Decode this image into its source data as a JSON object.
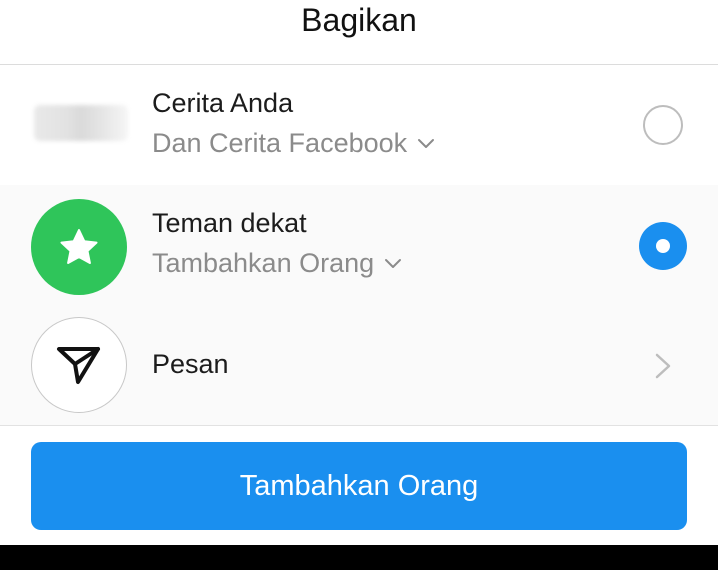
{
  "header": {
    "title": "Bagikan"
  },
  "options": [
    {
      "title": "Cerita Anda",
      "subtitle": "Dan Cerita Facebook",
      "selected": false
    },
    {
      "title": "Teman dekat",
      "subtitle": "Tambahkan Orang",
      "selected": true,
      "icon": "star-icon",
      "icon_bg": "#2fc55a"
    },
    {
      "title": "Pesan",
      "icon": "send-icon"
    }
  ],
  "footer": {
    "button_label": "Tambahkan Orang"
  },
  "colors": {
    "accent": "#1a8fef",
    "close_friends_green": "#2fc55a"
  }
}
